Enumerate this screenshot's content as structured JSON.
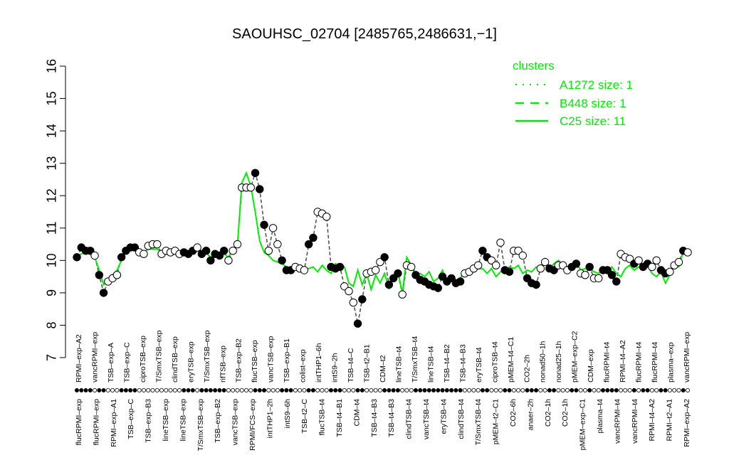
{
  "chart_data": {
    "type": "line",
    "title": "SAOUHSC_02704 [2485765,2486631,−1]",
    "xlabel": "",
    "ylabel": "",
    "ylim": [
      7,
      16
    ],
    "yticks": [
      7,
      8,
      9,
      10,
      11,
      12,
      13,
      14,
      15,
      16
    ],
    "grid": false,
    "legend": {
      "title": "clusters",
      "placement": "top-right",
      "color": "#00ee00",
      "entries": [
        {
          "label": "A1272 size: 1",
          "style": "dotted"
        },
        {
          "label": "B448 size: 1",
          "style": "dashed"
        },
        {
          "label": "C25 size: 11",
          "style": "solid"
        }
      ]
    },
    "top_labels": [
      "RPMI–exp–A2",
      "vancRPMI–exp",
      "TSB–exp–A",
      "TSB–exp–C",
      "ciproTSB–exp",
      "T/SmxTSB–exp",
      "clindTSB–exp",
      "eryTSB–exp",
      "T/SmxTSB–exp",
      "rifTSB–exp",
      "TSB–exp–B2",
      "flucTSB–exp",
      "vancTSB–exp",
      "TSB–exp–B1",
      "colist–exp",
      "intTHP1–6h",
      "intS9–2h",
      "TSB–t4–C",
      "TSB–t2–B1",
      "CDM–t2",
      "lineTSB–t4",
      "T/SmxTSB–t4",
      "lineTSB–t4",
      "TSB–t4–B2",
      "TSB–t4–B3",
      "eryTSB–t4",
      "ciproTSB–t4",
      "pMEM–t4–C1",
      "CO2–2h",
      "nonad50–1h",
      "nonad25–1h",
      "pMEM–exp–C2",
      "CDM–exp",
      "flucRPMI–t4",
      "RPMI–t4–A2",
      "flucRPMI–t4",
      "flucRPMI–t4",
      "plasma–exp",
      "vancRPMI–exp"
    ],
    "bottom_labels": [
      "flucRPMI–exp",
      "flucRPMI–exp",
      "RPMI–exp–A1",
      "TSB–exp–C",
      "TSB–exp–B3",
      "lineTSB–exp",
      "lineTSB–exp",
      "T/SmxTSB–exp",
      "TSB–exp–B2",
      "vancTSB–exp",
      "RPMI/FCS–exp",
      "intTHP1–2h",
      "intS9–6h",
      "TSB–t2–C",
      "flucTSB–t4",
      "TSB–t4–B1",
      "CDM–t4",
      "TSB–t4–B3",
      "TSB–t4–B3",
      "clindTSB–t4",
      "vancTSB–t4",
      "eryTSB–t4",
      "clindTSB–t4",
      "T/SmxTSB–t4",
      "pMEM–t2–C1",
      "CO2–6h",
      "anaer–2h",
      "CO2–1h",
      "CO2–1h",
      "pMEM–exp–C1",
      "plasma–t4",
      "vancRPMI–t4",
      "vancRPMI–t4",
      "RPMI–t4–A2",
      "RPMI–t2–A1",
      "RPMI–exp–A2"
    ],
    "series": [
      {
        "style": "dashed",
        "values": [
          10.1,
          10.4,
          10.3,
          10.3,
          10.15,
          9.55,
          9.0,
          9.35,
          9.45,
          9.55,
          10.1,
          10.3,
          10.4,
          10.4,
          10.25,
          10.2,
          10.45,
          10.5,
          10.5,
          10.2,
          10.3,
          10.25,
          10.3,
          10.2,
          10.25,
          10.2,
          10.3,
          10.4,
          10.2,
          10.3,
          10.0,
          10.2,
          10.15,
          10.3,
          10.0,
          10.3,
          10.5,
          12.25,
          12.25,
          12.25,
          12.7,
          12.2,
          11.1,
          10.3,
          11.0,
          10.5,
          10.0,
          9.7,
          9.7,
          9.8,
          9.75,
          9.7,
          10.5,
          10.7,
          11.5,
          11.45,
          11.35,
          9.8,
          9.75,
          9.8,
          9.2,
          9.05,
          8.7,
          8.05,
          8.8,
          9.6,
          9.65,
          9.7,
          9.95,
          10.1,
          9.25,
          9.45,
          9.6,
          8.95,
          9.85,
          9.8,
          9.55,
          9.4,
          9.35,
          9.25,
          9.2,
          9.15,
          9.5,
          9.35,
          9.45,
          9.3,
          9.35,
          9.6,
          9.65,
          9.75,
          9.85,
          10.3,
          10.1,
          10.0,
          9.85,
          10.55,
          9.7,
          9.65,
          10.3,
          10.3,
          10.15,
          9.45,
          9.3,
          9.25,
          9.75,
          9.95,
          9.75,
          9.7,
          9.85,
          9.85,
          9.7,
          9.8,
          9.9,
          9.6,
          9.55,
          9.8,
          9.45,
          9.45,
          9.7,
          9.7,
          9.55,
          9.35,
          10.2,
          10.1,
          10.05,
          9.9,
          10.0,
          9.8,
          9.9,
          9.8,
          10.0,
          9.7,
          9.6,
          9.65,
          9.85,
          9.95,
          10.3,
          10.25
        ],
        "filled": [
          true,
          true,
          true,
          true,
          false,
          true,
          true,
          false,
          false,
          false,
          true,
          true,
          true,
          true,
          false,
          false,
          false,
          false,
          false,
          false,
          false,
          false,
          false,
          false,
          true,
          true,
          true,
          false,
          true,
          true,
          true,
          true,
          true,
          true,
          false,
          false,
          false,
          false,
          false,
          false,
          true,
          true,
          true,
          false,
          false,
          false,
          true,
          true,
          true,
          false,
          false,
          false,
          true,
          true,
          false,
          false,
          false,
          true,
          true,
          true,
          false,
          false,
          false,
          true,
          true,
          false,
          false,
          false,
          false,
          true,
          true,
          true,
          true,
          false,
          false,
          false,
          true,
          true,
          true,
          true,
          true,
          true,
          true,
          true,
          true,
          true,
          true,
          false,
          false,
          false,
          false,
          true,
          true,
          false,
          false,
          false,
          true,
          true,
          false,
          false,
          false,
          true,
          true,
          true,
          false,
          false,
          true,
          true,
          false,
          false,
          false,
          true,
          true,
          false,
          false,
          true,
          false,
          false,
          true,
          true,
          true,
          true,
          false,
          false,
          false,
          true,
          false,
          true,
          true,
          false,
          false,
          true,
          true,
          false,
          false,
          false,
          true,
          false
        ]
      },
      {
        "style": "solid",
        "values": [
          10.1,
          10.2,
          10.25,
          10.2,
          10.1,
          9.7,
          9.25,
          9.4,
          9.55,
          9.7,
          10.0,
          10.25,
          10.3,
          10.35,
          10.3,
          10.25,
          10.35,
          10.35,
          10.35,
          10.25,
          10.3,
          10.25,
          10.25,
          10.2,
          10.2,
          10.25,
          10.3,
          10.3,
          10.2,
          10.25,
          10.1,
          10.15,
          10.15,
          10.2,
          10.1,
          10.35,
          10.45,
          12.4,
          12.7,
          12.3,
          11.5,
          10.6,
          10.25,
          10.15,
          10.0,
          9.95,
          9.9,
          9.8,
          9.75,
          9.8,
          9.8,
          9.7,
          9.75,
          9.8,
          9.65,
          9.85,
          9.7,
          9.6,
          9.9,
          9.85,
          9.8,
          9.3,
          9.2,
          9.7,
          9.25,
          9.6,
          9.1,
          9.55,
          9.3,
          9.6,
          9.15,
          9.55,
          9.65,
          9.0,
          10.1,
          9.85,
          9.6,
          9.6,
          9.5,
          9.65,
          9.35,
          9.45,
          9.7,
          9.3,
          9.5,
          9.35,
          9.45,
          9.7,
          9.65,
          9.75,
          9.75,
          9.75,
          9.6,
          9.75,
          9.5,
          9.65,
          9.7,
          9.8,
          9.75,
          9.85,
          9.6,
          9.7,
          9.65,
          9.8,
          9.75,
          10.05,
          9.75,
          9.9,
          10.0,
          9.85,
          9.8,
          9.9,
          9.95,
          9.7,
          9.75,
          9.75,
          9.65,
          9.6,
          9.7,
          9.65,
          9.8,
          9.6,
          9.5,
          9.75,
          9.85,
          9.7,
          9.8,
          9.75,
          9.85,
          9.6,
          9.5,
          9.65,
          9.3,
          9.55,
          9.85,
          9.8,
          10.3,
          10.25
        ]
      }
    ]
  }
}
